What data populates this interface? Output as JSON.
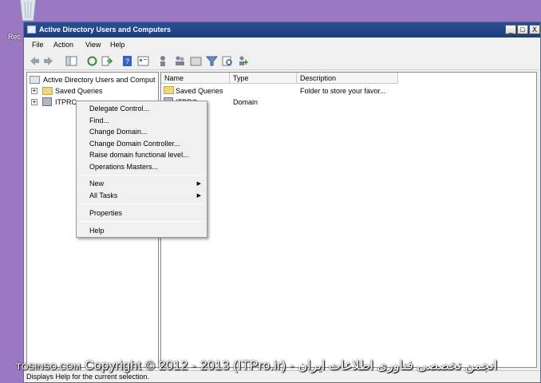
{
  "desktop": {
    "recycle_bin_label": "Rec"
  },
  "window": {
    "title": "Active Directory Users and Computers",
    "controls": {
      "minimize": "_",
      "maximize": "□",
      "close": "X"
    }
  },
  "menu": {
    "file": "File",
    "action": "Action",
    "view": "View",
    "help": "Help"
  },
  "toolbar_icons": [
    "back-icon",
    "forward-icon",
    "up-icon",
    "show-console-tree-icon",
    "refresh-icon",
    "export-icon",
    "help-icon",
    "properties-icon",
    "users-icon",
    "groups-icon",
    "ou-icon",
    "filter-icon",
    "find-icon",
    "add-to-group-icon"
  ],
  "tree": {
    "root": "Active Directory Users and Comput",
    "saved_queries": "Saved Queries",
    "domain": "ITPRO"
  },
  "list": {
    "columns": {
      "name": "Name",
      "type": "Type",
      "description": "Description"
    },
    "rows": [
      {
        "name": "Saved Queries",
        "type": "",
        "description": "Folder to store your favor..."
      },
      {
        "name": "ITPRO",
        "type": "Domain",
        "description": ""
      }
    ]
  },
  "context_menu": {
    "delegate_control": "Delegate Control...",
    "find": "Find...",
    "change_domain": "Change Domain...",
    "change_dc": "Change Domain Controller...",
    "raise_level": "Raise domain functional level...",
    "operations_masters": "Operations Masters...",
    "new": "New",
    "all_tasks": "All Tasks",
    "properties": "Properties",
    "help": "Help",
    "submenu_arrow": "▶"
  },
  "status_text": "Displays Help for the current selection.",
  "watermark": "Copyright © 2012 - 2013 (ITPro.ir) - انجمن تخصصی فناوری اطلاعات ایران",
  "watermark_left": "TOSINSO.COM"
}
